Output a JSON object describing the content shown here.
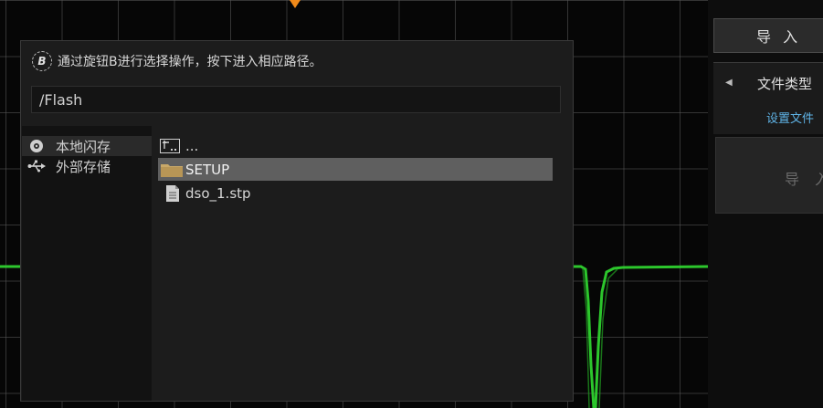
{
  "dialog": {
    "hint_knob": "B",
    "hint_text": "通过旋钮B进行选择操作，按下进入相应路径。",
    "path": "/Flash",
    "drives": [
      {
        "label": "本地闪存",
        "icon": "disk-icon",
        "selected": true
      },
      {
        "label": "外部存储",
        "icon": "usb-icon",
        "selected": false
      }
    ],
    "files": [
      {
        "label": "...",
        "icon": "parent-folder-icon",
        "selected": false
      },
      {
        "label": "SETUP",
        "icon": "folder-icon",
        "selected": true
      },
      {
        "label": "dso_1.stp",
        "icon": "file-icon",
        "selected": false
      }
    ]
  },
  "side_panel": {
    "title": "导 入",
    "file_type_label": "文件类型",
    "file_type_sub": "设置文件",
    "import_label": "导 入"
  },
  "colors": {
    "waveform": "#2fd12f",
    "trigger_marker": "#f08a1a",
    "subtext_blue": "#5fb3e6",
    "selected_file": "#5f5f5f"
  }
}
